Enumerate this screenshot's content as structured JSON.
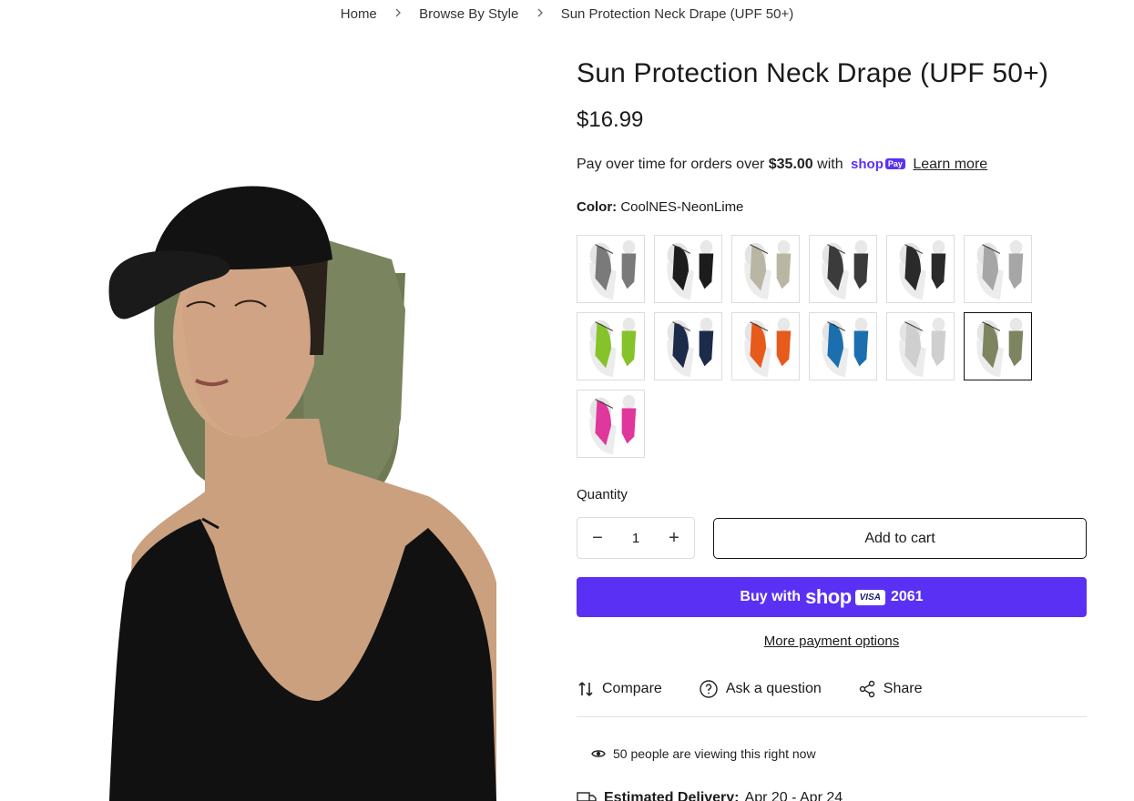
{
  "breadcrumb": {
    "home": "Home",
    "category": "Browse By Style",
    "current": "Sun Protection Neck Drape (UPF 50+)"
  },
  "product": {
    "title": "Sun Protection Neck Drape (UPF 50+)",
    "price": "$16.99",
    "installments": {
      "prefix": "Pay over time for orders over",
      "amount": "$35.00",
      "suffix": "with",
      "brand": "shop",
      "brand_tag": "Pay",
      "learn_more": "Learn more"
    },
    "color_label": "Color:",
    "color_value": "CoolNES-NeonLime",
    "swatches": [
      {
        "name": "gray",
        "color": "#7a7a7a"
      },
      {
        "name": "black",
        "color": "#1c1c1c"
      },
      {
        "name": "khaki",
        "color": "#b9b7a3"
      },
      {
        "name": "camo",
        "color": "#3b3b3b"
      },
      {
        "name": "black-orange",
        "color": "#2a2a2a"
      },
      {
        "name": "light-gray",
        "color": "#a6a6a6"
      },
      {
        "name": "lime",
        "color": "#86c22a"
      },
      {
        "name": "navy",
        "color": "#1d2b4a"
      },
      {
        "name": "orange",
        "color": "#e65a1c"
      },
      {
        "name": "blue",
        "color": "#1b6fae"
      },
      {
        "name": "silver",
        "color": "#cfcfcf"
      },
      {
        "name": "olive",
        "color": "#7d8460"
      },
      {
        "name": "pink",
        "color": "#e0379c"
      }
    ],
    "selected_swatch_index": 11
  },
  "purchase": {
    "quantity_label": "Quantity",
    "quantity": "1",
    "minus": "−",
    "plus": "+",
    "add_to_cart": "Add to cart",
    "buy_prefix": "Buy with",
    "buy_brand": "shop",
    "card_brand": "VISA",
    "card_last4": "2061",
    "more_options": "More payment options"
  },
  "actions": {
    "compare": "Compare",
    "ask": "Ask a question",
    "share": "Share"
  },
  "viewing": "50 people are viewing this right now",
  "delivery": {
    "label": "Estimated Delivery:",
    "value": "Apr 20 - Apr 24"
  },
  "colors": {
    "shop_purple": "#5a31f4",
    "drape_olive": "#6f7a55",
    "text": "#1a1a1a"
  }
}
